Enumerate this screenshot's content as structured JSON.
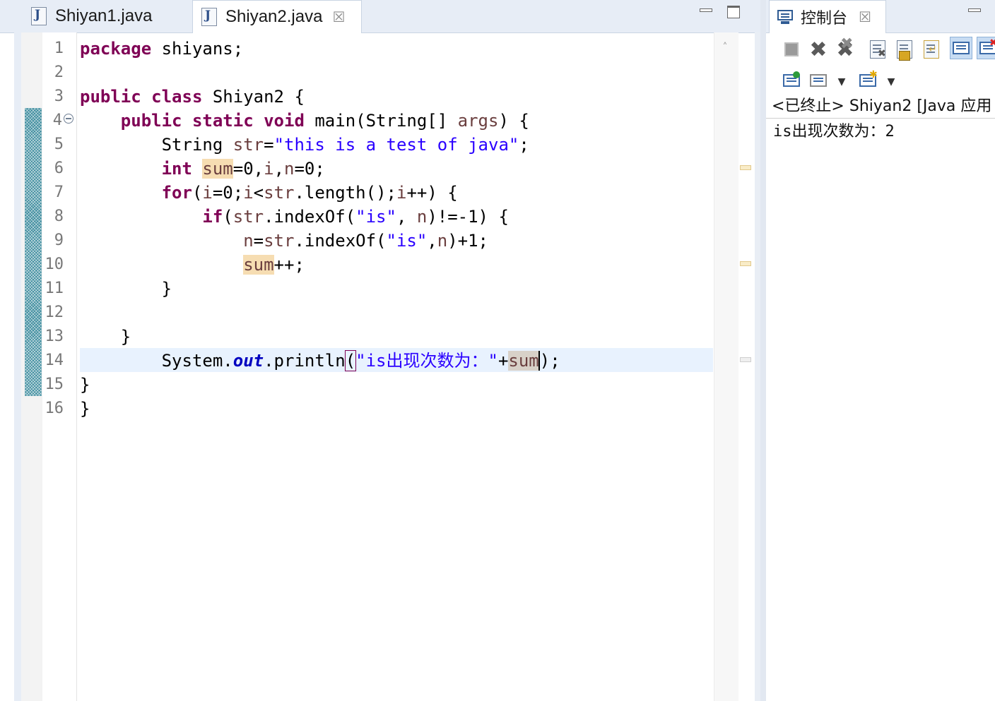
{
  "editor": {
    "tabs": [
      {
        "label": "Shiyan1.java",
        "icon": "java-file-icon",
        "active": false
      },
      {
        "label": "Shiyan2.java",
        "icon": "java-file-icon",
        "active": true,
        "close": "☒"
      }
    ],
    "lines": [
      "1",
      "2",
      "3",
      "4",
      "5",
      "6",
      "7",
      "8",
      "9",
      "10",
      "11",
      "12",
      "13",
      "14",
      "15",
      "16"
    ],
    "code": {
      "l1": {
        "kw": "package",
        "rest": " shiyans;"
      },
      "l3": {
        "kw1": "public",
        "kw2": "class",
        "rest": " Shiyan2 {"
      },
      "l4": {
        "indent": "    ",
        "kw1": "public",
        "kw2": "static",
        "kw3": "void",
        "a": " main(String[] ",
        "param": "args",
        "b": ") {"
      },
      "l5": {
        "indent": "        ",
        "a": "String ",
        "var": "str",
        "eq": "=",
        "str": "\"this is a test of java\"",
        "end": ";"
      },
      "l6": {
        "indent": "        ",
        "kw": "int",
        "sp": " ",
        "sum": "sum",
        "e1": "=0,",
        "i": "i",
        "c": ",",
        "n": "n",
        "e2": "=0;"
      },
      "l7": {
        "indent": "        ",
        "kw": "for",
        "a": "(",
        "i1": "i",
        "b": "=0;",
        "i2": "i",
        "c": "<",
        "s": "str",
        "d": ".length();",
        "i3": "i",
        "e": "++) {"
      },
      "l8": {
        "indent": "            ",
        "kw": "if",
        "a": "(",
        "s": "str",
        "b": ".indexOf(",
        "str": "\"is\"",
        "c": ", ",
        "n": "n",
        "d": ")!=-1) {"
      },
      "l9": {
        "indent": "                ",
        "n": "n",
        "a": "=",
        "s": "str",
        "b": ".indexOf(",
        "str": "\"is\"",
        "c": ",",
        "n2": "n",
        "d": ")+1;"
      },
      "l10": {
        "indent": "                ",
        "sum": "sum",
        "rest": "++;"
      },
      "l11": {
        "indent": "        ",
        "rest": "}"
      },
      "l13": {
        "indent": "    ",
        "rest": "}"
      },
      "l14": {
        "indent": "        ",
        "a": "System.",
        "out": "out",
        "b": ".println",
        "paren": "(",
        "str": "\"is出现次数为：\"",
        "plus": "+",
        "sum": "sum",
        "end": ");"
      },
      "l15": {
        "rest": "}"
      },
      "l16": {
        "rest": "}"
      }
    }
  },
  "console": {
    "tab_label": "控制台",
    "tab_close": "☒",
    "header": "<已终止> Shiyan2 [Java 应用",
    "output": "is出现次数为：2"
  },
  "icons": {
    "terminate": "terminate-icon",
    "remove_launch": "remove-launch-icon",
    "remove_all": "remove-all-terminated-icon",
    "clear": "clear-console-icon",
    "scroll_lock": "scroll-lock-icon",
    "word_wrap": "word-wrap-icon",
    "pin": "pin-console-icon",
    "display_selected": "display-selected-console-icon",
    "open_console": "open-console-icon",
    "new_console": "new-console-icon"
  },
  "colors": {
    "keyword": "#7f0055",
    "string": "#2a00ff",
    "local_var": "#6a3e3e",
    "static_field": "#0000c0",
    "occurrence": "#f6ddb2",
    "current_line": "#e8f2fe",
    "tab_bar": "#e7edf6"
  }
}
